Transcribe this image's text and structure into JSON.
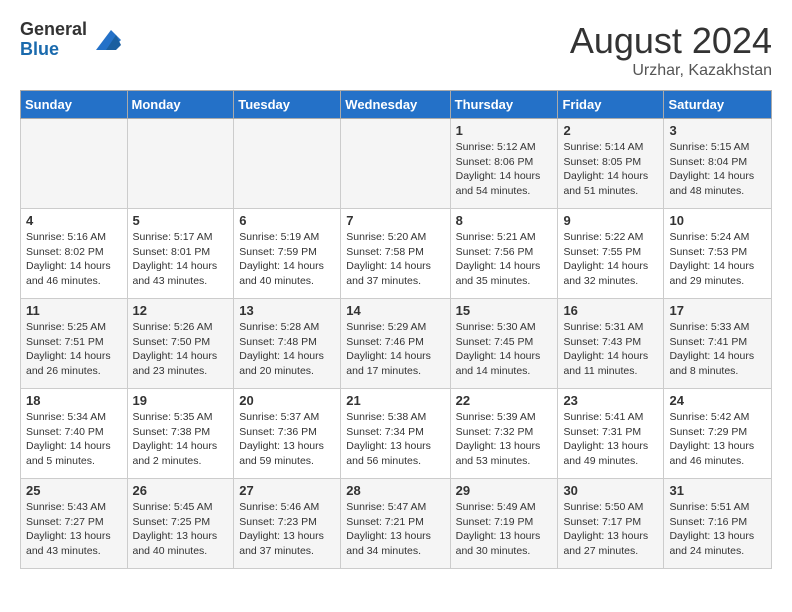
{
  "logo": {
    "general": "General",
    "blue": "Blue"
  },
  "title": {
    "month_year": "August 2024",
    "location": "Urzhar, Kazakhstan"
  },
  "days_of_week": [
    "Sunday",
    "Monday",
    "Tuesday",
    "Wednesday",
    "Thursday",
    "Friday",
    "Saturday"
  ],
  "weeks": [
    [
      {
        "day": "",
        "detail": ""
      },
      {
        "day": "",
        "detail": ""
      },
      {
        "day": "",
        "detail": ""
      },
      {
        "day": "",
        "detail": ""
      },
      {
        "day": "1",
        "detail": "Sunrise: 5:12 AM\nSunset: 8:06 PM\nDaylight: 14 hours\nand 54 minutes."
      },
      {
        "day": "2",
        "detail": "Sunrise: 5:14 AM\nSunset: 8:05 PM\nDaylight: 14 hours\nand 51 minutes."
      },
      {
        "day": "3",
        "detail": "Sunrise: 5:15 AM\nSunset: 8:04 PM\nDaylight: 14 hours\nand 48 minutes."
      }
    ],
    [
      {
        "day": "4",
        "detail": "Sunrise: 5:16 AM\nSunset: 8:02 PM\nDaylight: 14 hours\nand 46 minutes."
      },
      {
        "day": "5",
        "detail": "Sunrise: 5:17 AM\nSunset: 8:01 PM\nDaylight: 14 hours\nand 43 minutes."
      },
      {
        "day": "6",
        "detail": "Sunrise: 5:19 AM\nSunset: 7:59 PM\nDaylight: 14 hours\nand 40 minutes."
      },
      {
        "day": "7",
        "detail": "Sunrise: 5:20 AM\nSunset: 7:58 PM\nDaylight: 14 hours\nand 37 minutes."
      },
      {
        "day": "8",
        "detail": "Sunrise: 5:21 AM\nSunset: 7:56 PM\nDaylight: 14 hours\nand 35 minutes."
      },
      {
        "day": "9",
        "detail": "Sunrise: 5:22 AM\nSunset: 7:55 PM\nDaylight: 14 hours\nand 32 minutes."
      },
      {
        "day": "10",
        "detail": "Sunrise: 5:24 AM\nSunset: 7:53 PM\nDaylight: 14 hours\nand 29 minutes."
      }
    ],
    [
      {
        "day": "11",
        "detail": "Sunrise: 5:25 AM\nSunset: 7:51 PM\nDaylight: 14 hours\nand 26 minutes."
      },
      {
        "day": "12",
        "detail": "Sunrise: 5:26 AM\nSunset: 7:50 PM\nDaylight: 14 hours\nand 23 minutes."
      },
      {
        "day": "13",
        "detail": "Sunrise: 5:28 AM\nSunset: 7:48 PM\nDaylight: 14 hours\nand 20 minutes."
      },
      {
        "day": "14",
        "detail": "Sunrise: 5:29 AM\nSunset: 7:46 PM\nDaylight: 14 hours\nand 17 minutes."
      },
      {
        "day": "15",
        "detail": "Sunrise: 5:30 AM\nSunset: 7:45 PM\nDaylight: 14 hours\nand 14 minutes."
      },
      {
        "day": "16",
        "detail": "Sunrise: 5:31 AM\nSunset: 7:43 PM\nDaylight: 14 hours\nand 11 minutes."
      },
      {
        "day": "17",
        "detail": "Sunrise: 5:33 AM\nSunset: 7:41 PM\nDaylight: 14 hours\nand 8 minutes."
      }
    ],
    [
      {
        "day": "18",
        "detail": "Sunrise: 5:34 AM\nSunset: 7:40 PM\nDaylight: 14 hours\nand 5 minutes."
      },
      {
        "day": "19",
        "detail": "Sunrise: 5:35 AM\nSunset: 7:38 PM\nDaylight: 14 hours\nand 2 minutes."
      },
      {
        "day": "20",
        "detail": "Sunrise: 5:37 AM\nSunset: 7:36 PM\nDaylight: 13 hours\nand 59 minutes."
      },
      {
        "day": "21",
        "detail": "Sunrise: 5:38 AM\nSunset: 7:34 PM\nDaylight: 13 hours\nand 56 minutes."
      },
      {
        "day": "22",
        "detail": "Sunrise: 5:39 AM\nSunset: 7:32 PM\nDaylight: 13 hours\nand 53 minutes."
      },
      {
        "day": "23",
        "detail": "Sunrise: 5:41 AM\nSunset: 7:31 PM\nDaylight: 13 hours\nand 49 minutes."
      },
      {
        "day": "24",
        "detail": "Sunrise: 5:42 AM\nSunset: 7:29 PM\nDaylight: 13 hours\nand 46 minutes."
      }
    ],
    [
      {
        "day": "25",
        "detail": "Sunrise: 5:43 AM\nSunset: 7:27 PM\nDaylight: 13 hours\nand 43 minutes."
      },
      {
        "day": "26",
        "detail": "Sunrise: 5:45 AM\nSunset: 7:25 PM\nDaylight: 13 hours\nand 40 minutes."
      },
      {
        "day": "27",
        "detail": "Sunrise: 5:46 AM\nSunset: 7:23 PM\nDaylight: 13 hours\nand 37 minutes."
      },
      {
        "day": "28",
        "detail": "Sunrise: 5:47 AM\nSunset: 7:21 PM\nDaylight: 13 hours\nand 34 minutes."
      },
      {
        "day": "29",
        "detail": "Sunrise: 5:49 AM\nSunset: 7:19 PM\nDaylight: 13 hours\nand 30 minutes."
      },
      {
        "day": "30",
        "detail": "Sunrise: 5:50 AM\nSunset: 7:17 PM\nDaylight: 13 hours\nand 27 minutes."
      },
      {
        "day": "31",
        "detail": "Sunrise: 5:51 AM\nSunset: 7:16 PM\nDaylight: 13 hours\nand 24 minutes."
      }
    ]
  ]
}
